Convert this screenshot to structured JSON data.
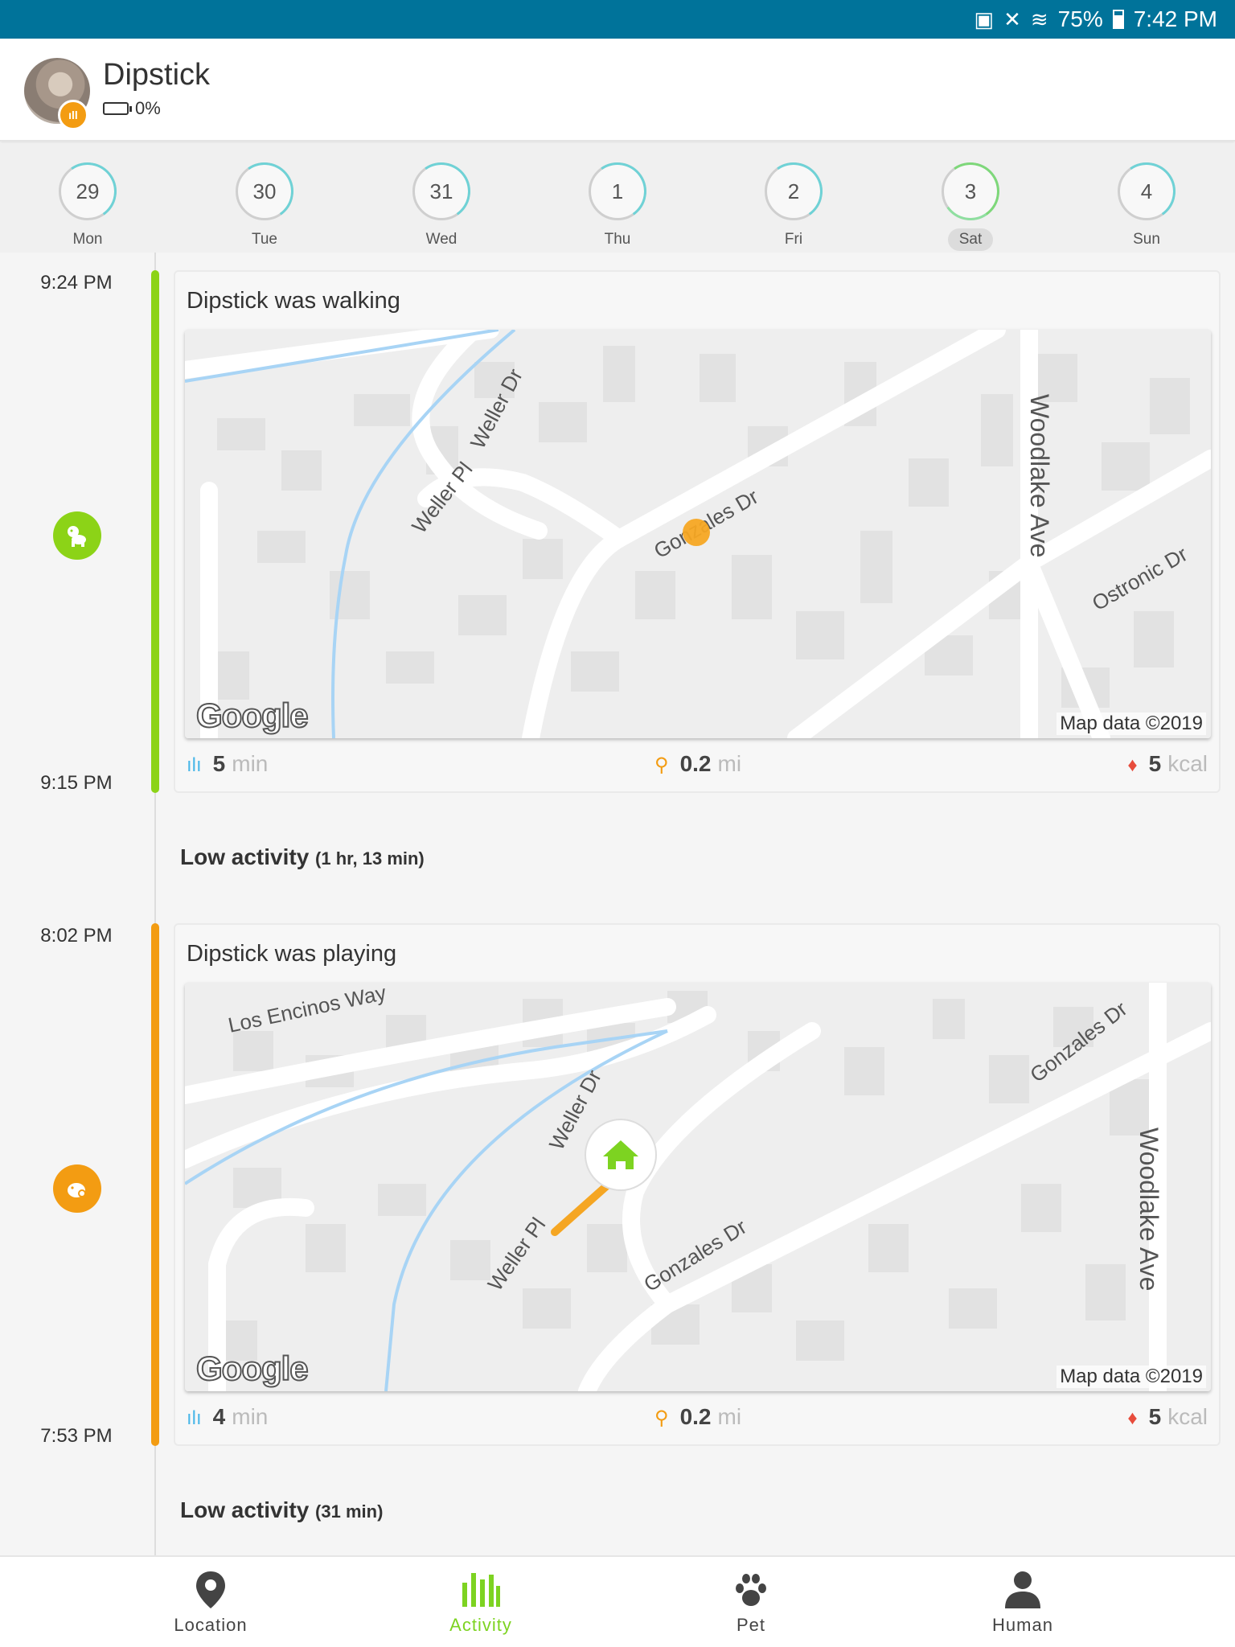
{
  "status_bar": {
    "battery": "75%",
    "time": "7:42 PM"
  },
  "header": {
    "pet_name": "Dipstick",
    "battery": "0%"
  },
  "days": [
    {
      "num": "29",
      "label": "Mon"
    },
    {
      "num": "30",
      "label": "Tue"
    },
    {
      "num": "31",
      "label": "Wed"
    },
    {
      "num": "1",
      "label": "Thu"
    },
    {
      "num": "2",
      "label": "Fri"
    },
    {
      "num": "3",
      "label": "Sat",
      "selected": true
    },
    {
      "num": "4",
      "label": "Sun"
    }
  ],
  "activities": [
    {
      "start": "9:24 PM",
      "end": "9:15 PM",
      "title": "Dipstick was walking",
      "color": "#8cd317",
      "map": {
        "streets": [
          "Weller Dr",
          "Weller Pl",
          "Gonzales Dr",
          "Woodlake Ave",
          "Ostronic Dr"
        ],
        "attribution": "Map data ©2019",
        "logo": "Google"
      },
      "duration": {
        "value": "5",
        "unit": "min"
      },
      "distance": {
        "value": "0.2",
        "unit": "mi"
      },
      "calories": {
        "value": "5",
        "unit": "kcal"
      }
    },
    {
      "start": "8:02 PM",
      "end": "7:53 PM",
      "title": "Dipstick was playing",
      "color": "#f39c12",
      "map": {
        "streets": [
          "Los Encinos Way",
          "Weller Dr",
          "Weller Pl",
          "Gonzales Dr",
          "Gonzales Dr",
          "Woodlake Ave"
        ],
        "attribution": "Map data ©2019",
        "logo": "Google"
      },
      "duration": {
        "value": "4",
        "unit": "min"
      },
      "distance": {
        "value": "0.2",
        "unit": "mi"
      },
      "calories": {
        "value": "5",
        "unit": "kcal"
      }
    }
  ],
  "low_activity": [
    {
      "label": "Low activity",
      "duration": "(1 hr, 13 min)"
    },
    {
      "label": "Low activity",
      "duration": "(31 min)"
    }
  ],
  "nav": [
    {
      "label": "Location"
    },
    {
      "label": "Activity",
      "active": true
    },
    {
      "label": "Pet"
    },
    {
      "label": "Human"
    }
  ]
}
